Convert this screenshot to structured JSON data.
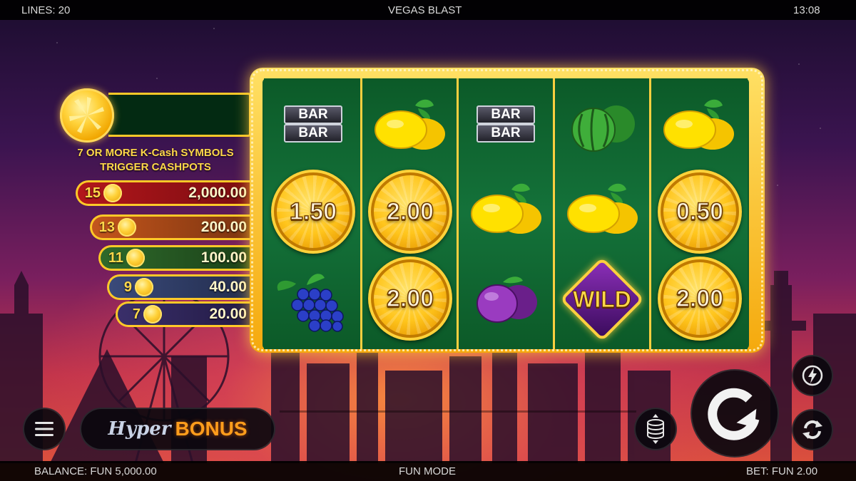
{
  "topbar": {
    "lines": "LINES: 20",
    "title": "VEGAS BLAST",
    "clock": "13:08"
  },
  "bottombar": {
    "balance": "BALANCE: FUN 5,000.00",
    "mode": "FUN MODE",
    "bet": "BET: FUN 2.00"
  },
  "cashpots": {
    "caption_line1": "7 OR MORE K-Cash SYMBOLS",
    "caption_line2": "TRIGGER CASHPOTS",
    "tiers": [
      {
        "count": "15",
        "value": "2,000.00",
        "color": "#b3161b"
      },
      {
        "count": "13",
        "value": "200.00",
        "color": "#c4561c"
      },
      {
        "count": "11",
        "value": "100.00",
        "color": "#2f6a2b"
      },
      {
        "count": "9",
        "value": "40.00",
        "color": "#3a4a7a"
      },
      {
        "count": "7",
        "value": "20.00",
        "color": "#3a2f6a"
      }
    ]
  },
  "reels": [
    [
      "BAR BAR",
      "coin 1.50",
      "grapes"
    ],
    [
      "lemon",
      "coin 2.00",
      "coin 2.00"
    ],
    [
      "BAR BAR",
      "lemon",
      "plum"
    ],
    [
      "watermelon",
      "lemon",
      "WILD"
    ],
    [
      "lemon",
      "coin 0.50",
      "coin 2.00"
    ]
  ],
  "symbols": {
    "bar_label": "BAR",
    "wild_label": "WILD",
    "coin_values": {
      "r1c1": "1.50",
      "r2c1": "2.00",
      "r2c2": "2.00",
      "r5c1": "0.50",
      "r5c2": "2.00"
    }
  },
  "controls": {
    "menu_icon": "hamburger-menu-icon",
    "hyper_part1": "Hyper",
    "hyper_part2": "BONUS",
    "bet_icon": "coin-stack-icon",
    "spin_icon": "spin-arrow-icon",
    "turbo_icon": "lightning-icon",
    "autoplay_icon": "autoplay-arrows-icon"
  },
  "colors": {
    "gold": "#ffc928",
    "reel_green": "#0f5a2a",
    "bonus_orange": "#ff9d1c"
  }
}
